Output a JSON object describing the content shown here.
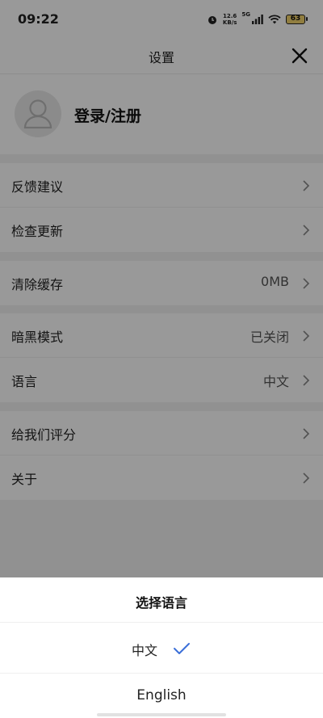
{
  "status_bar": {
    "time": "09:22",
    "net_speed_value": "12.6",
    "net_speed_unit": "KB/s",
    "network": "5G",
    "battery": "63"
  },
  "header": {
    "title": "设置"
  },
  "profile": {
    "login_label": "登录/注册"
  },
  "groups": [
    {
      "items": [
        {
          "label": "反馈建议"
        },
        {
          "label": "检查更新"
        }
      ]
    },
    {
      "items": [
        {
          "label": "清除缓存",
          "value": "0MB"
        }
      ]
    },
    {
      "items": [
        {
          "label": "暗黑模式",
          "value": "已关闭"
        },
        {
          "label": "语言",
          "value": "中文"
        }
      ]
    },
    {
      "items": [
        {
          "label": "给我们评分"
        },
        {
          "label": "关于"
        }
      ]
    }
  ],
  "language_sheet": {
    "title": "选择语言",
    "options": [
      {
        "label": "中文",
        "selected": true
      },
      {
        "label": "English",
        "selected": false
      }
    ],
    "accent_color": "#3b6fd8"
  }
}
